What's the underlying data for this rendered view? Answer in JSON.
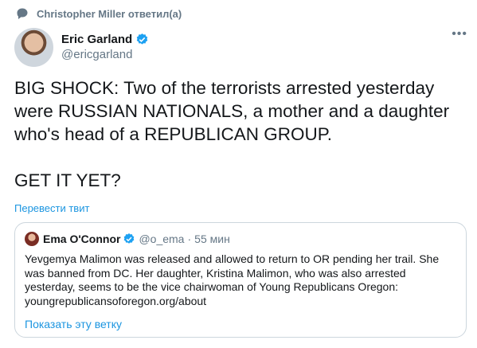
{
  "reply_context": {
    "icon": "speech-bubble-icon",
    "text": "Christopher Miller ответил(а)"
  },
  "author": {
    "name": "Eric Garland",
    "handle": "@ericgarland",
    "verified_icon": "verified-badge-icon",
    "more_icon": "more-options-icon"
  },
  "tweet": {
    "text": "BIG SHOCK: Two of the terrorists arrested yesterday were RUSSIAN NATIONALS, a mother and a daughter who's head of a REPUBLICAN GROUP.\n\nGET IT YET?",
    "translate_label": "Перевести твит"
  },
  "quoted": {
    "name": "Ema O'Connor",
    "handle": "@o_ema",
    "separator": "·",
    "time": "55 мин",
    "text": "Yevgemya Malimon was released and allowed to return to OR pending her trail. She was banned from DC. Her daughter, Kristina Malimon, who was also arrested yesterday, seems to be the vice chairwoman of Young Republicans Oregon: youngrepublicansoforegon.org/about",
    "show_thread_label": "Показать эту ветку"
  },
  "colors": {
    "accent": "#1b95e0",
    "verified": "#1da1f2",
    "muted": "#657786",
    "border": "#ccd6dd"
  }
}
